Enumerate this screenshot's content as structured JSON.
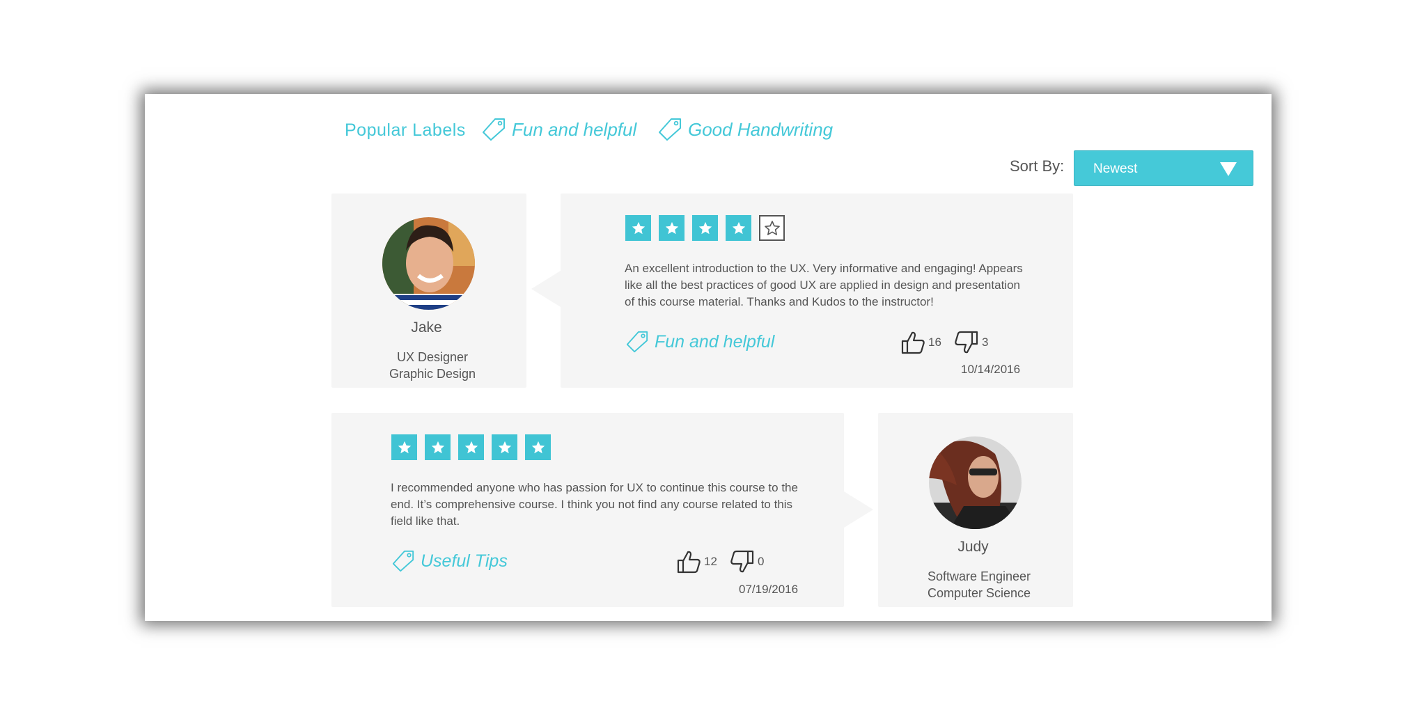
{
  "labels": {
    "title": "Popular Labels",
    "tags": [
      "Fun and helpful",
      "Good Handwriting"
    ]
  },
  "sort": {
    "label": "Sort By:",
    "value": "Newest"
  },
  "reviews": [
    {
      "name": "Jake",
      "role_line1": "UX Designer",
      "role_line2": "Graphic Design",
      "rating": 4,
      "rating_max": 5,
      "text": "An excellent introduction to the UX. Very informative and engaging! Appears like all the best practices of good UX are applied in design and presentation of this course material. Thanks and Kudos to the instructor!",
      "tag": "Fun and helpful",
      "likes": "16",
      "dislikes": "3",
      "date": "10/14/2016"
    },
    {
      "name": "Judy",
      "role_line1": "Software Engineer",
      "role_line2": "Computer Science",
      "rating": 5,
      "rating_max": 5,
      "text": "I recommended anyone who has passion for UX to continue this course to the end. It’s comprehensive course. I think you not find any course related to this field like that.",
      "tag": "Useful Tips",
      "likes": "12",
      "dislikes": "0",
      "date": "07/19/2016"
    }
  ],
  "colors": {
    "accent": "#44c8d8",
    "panel": "#f5f5f5",
    "text": "#555555"
  },
  "icons": [
    "tag-icon",
    "star-icon",
    "thumbs-up-icon",
    "thumbs-down-icon",
    "dropdown-caret-icon",
    "avatar-photo"
  ]
}
